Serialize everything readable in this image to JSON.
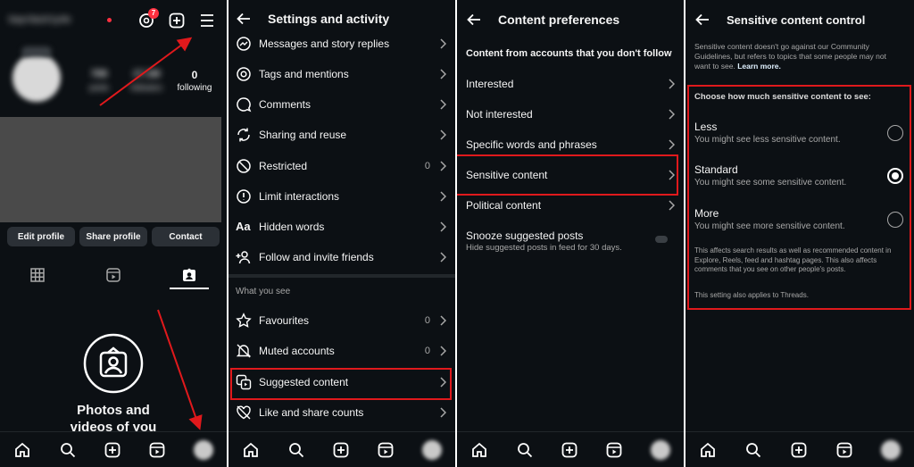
{
  "profile": {
    "username": "bay•3aclr1y4e",
    "threads_badge": "7",
    "posts_count": "708",
    "posts_label": "posts",
    "followers_count": "17.1M",
    "followers_label": "followers",
    "following_count": "0",
    "following_label": "following",
    "edit_profile": "Edit profile",
    "share_profile": "Share profile",
    "contact": "Contact",
    "empty_title": "Photos and videos of you"
  },
  "settings": {
    "title": "Settings and activity",
    "items": [
      {
        "label": "Messages and story replies",
        "count": ""
      },
      {
        "label": "Tags and mentions",
        "count": ""
      },
      {
        "label": "Comments",
        "count": ""
      },
      {
        "label": "Sharing and reuse",
        "count": ""
      },
      {
        "label": "Restricted",
        "count": "0"
      },
      {
        "label": "Limit interactions",
        "count": ""
      },
      {
        "label": "Hidden words",
        "count": ""
      },
      {
        "label": "Follow and invite friends",
        "count": ""
      }
    ],
    "section": "What you see",
    "see_items": [
      {
        "label": "Favourites",
        "count": "0"
      },
      {
        "label": "Muted accounts",
        "count": "0"
      },
      {
        "label": "Suggested content",
        "count": ""
      },
      {
        "label": "Like and share counts",
        "count": ""
      }
    ]
  },
  "content_prefs": {
    "title": "Content preferences",
    "subtitle": "Content from accounts that you don't follow",
    "items": [
      "Interested",
      "Not interested",
      "Specific words and phrases",
      "Sensitive content",
      "Political content"
    ],
    "snooze_title": "Snooze suggested posts",
    "snooze_sub": "Hide suggested posts in feed for 30 days."
  },
  "sensitive": {
    "title": "Sensitive content control",
    "intro": "Sensitive content doesn't go against our Community Guidelines, but refers to topics that some people may not want to see.",
    "learn_more": "Learn more.",
    "prompt": "Choose how much sensitive content to see:",
    "options": [
      {
        "title": "Less",
        "sub": "You might see less sensitive content."
      },
      {
        "title": "Standard",
        "sub": "You might see some sensitive content."
      },
      {
        "title": "More",
        "sub": "You might see more sensitive content."
      }
    ],
    "selected": "Standard",
    "note1": "This affects search results as well as recommended content in Explore, Reels, feed and hashtag pages. This also affects comments that you see on other people's posts.",
    "note2": "This setting also applies to Threads."
  },
  "colors": {
    "background": "#0c1014",
    "highlight": "#e0191c",
    "muted_text": "#a8a8a8"
  }
}
